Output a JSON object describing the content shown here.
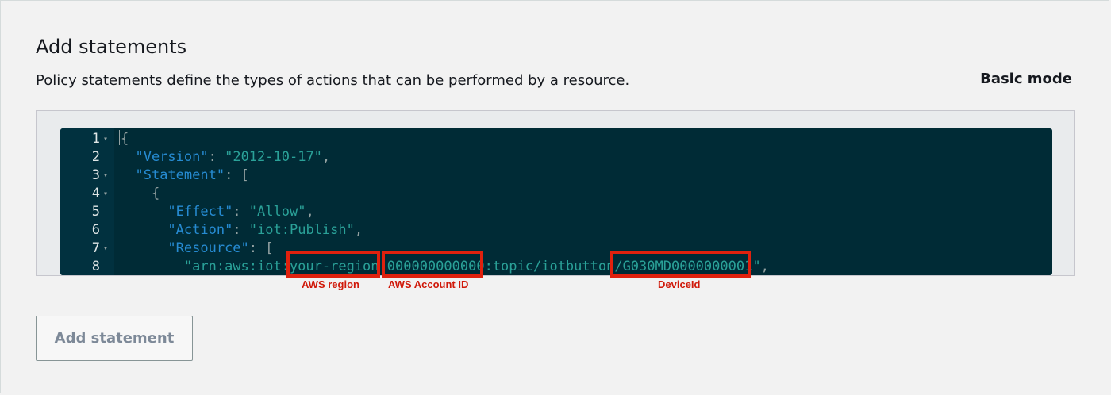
{
  "header": {
    "title": "Add statements",
    "description": "Policy statements define the types of actions that can be performed by a resource.",
    "mode_link": "Basic mode"
  },
  "editor": {
    "lines": [
      {
        "n": "1",
        "fold": true,
        "parts": [
          {
            "t": "{",
            "c": "p"
          }
        ]
      },
      {
        "n": "2",
        "fold": false,
        "parts": [
          {
            "t": "  ",
            "c": "p"
          },
          {
            "t": "\"Version\"",
            "c": "k"
          },
          {
            "t": ": ",
            "c": "p"
          },
          {
            "t": "\"2012-10-17\"",
            "c": "s"
          },
          {
            "t": ",",
            "c": "p"
          }
        ]
      },
      {
        "n": "3",
        "fold": true,
        "parts": [
          {
            "t": "  ",
            "c": "p"
          },
          {
            "t": "\"Statement\"",
            "c": "k"
          },
          {
            "t": ": [",
            "c": "p"
          }
        ]
      },
      {
        "n": "4",
        "fold": true,
        "parts": [
          {
            "t": "    {",
            "c": "p"
          }
        ]
      },
      {
        "n": "5",
        "fold": false,
        "parts": [
          {
            "t": "      ",
            "c": "p"
          },
          {
            "t": "\"Effect\"",
            "c": "k"
          },
          {
            "t": ": ",
            "c": "p"
          },
          {
            "t": "\"Allow\"",
            "c": "s"
          },
          {
            "t": ",",
            "c": "p"
          }
        ]
      },
      {
        "n": "6",
        "fold": false,
        "parts": [
          {
            "t": "      ",
            "c": "p"
          },
          {
            "t": "\"Action\"",
            "c": "k"
          },
          {
            "t": ": ",
            "c": "p"
          },
          {
            "t": "\"iot:Publish\"",
            "c": "s"
          },
          {
            "t": ",",
            "c": "p"
          }
        ]
      },
      {
        "n": "7",
        "fold": true,
        "parts": [
          {
            "t": "      ",
            "c": "p"
          },
          {
            "t": "\"Resource\"",
            "c": "k"
          },
          {
            "t": ": [",
            "c": "p"
          }
        ]
      },
      {
        "n": "8",
        "fold": false,
        "parts": [
          {
            "t": "        ",
            "c": "p"
          },
          {
            "t": "\"arn:aws:iot:your-region:000000000000:topic/iotbutton/G030MD0000000001\"",
            "c": "s"
          },
          {
            "t": ",",
            "c": "p"
          }
        ]
      }
    ]
  },
  "annotations": [
    {
      "label": "AWS region"
    },
    {
      "label": "AWS Account ID"
    },
    {
      "label": "DeviceId"
    }
  ],
  "footer": {
    "add_statement_label": "Add statement"
  },
  "colors": {
    "editor_bg": "#002b36",
    "json_key": "#268bd2",
    "json_string": "#2aa198",
    "highlight": "#e0210e"
  }
}
